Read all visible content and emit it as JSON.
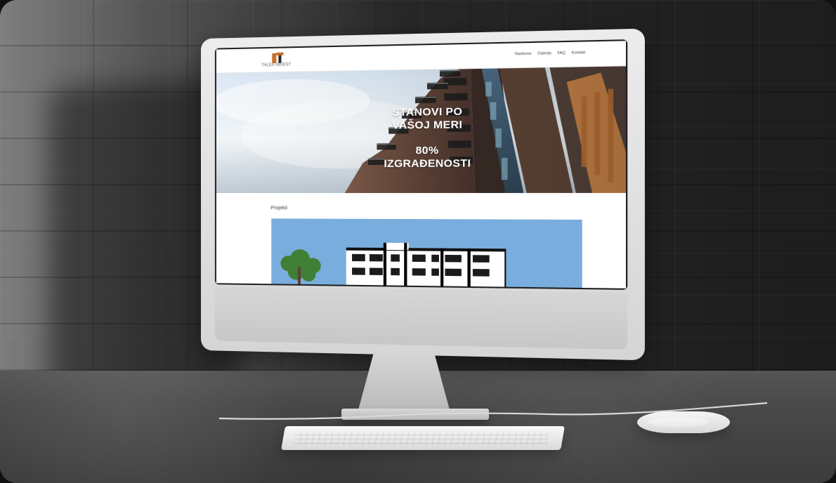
{
  "site": {
    "logo_text": "TALEA INVEST",
    "nav": [
      "Naslovna",
      "Galerija",
      "FAQ",
      "Kontakt"
    ],
    "hero": {
      "line1": "STANOVI PO",
      "line2": "VAŠOJ MERI",
      "line3": "80% IZGRAĐENOSTI"
    },
    "section_title": "Projekti"
  },
  "colors": {
    "logo_orange": "#c9702e",
    "logo_dark": "#2f2a25"
  },
  "icons": {
    "logo_mark": "logo-mark-icon"
  }
}
